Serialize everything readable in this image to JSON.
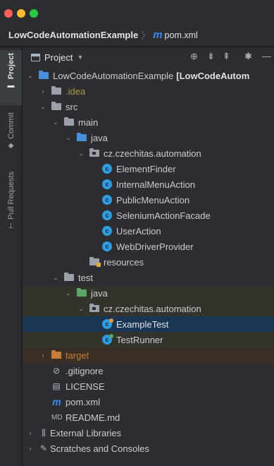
{
  "breadcrumb": {
    "project": "LowCodeAutomationExample",
    "separator": "〉",
    "file_icon": "m",
    "file": "pom.xml"
  },
  "side_tabs": {
    "project": "Project",
    "commit": "Commit",
    "pull_requests": "Pull Requests"
  },
  "toolbar": {
    "title": "Project",
    "caret": "▼",
    "locate_icon": "⊕",
    "expand_icon": "⇟",
    "collapse_icon": "⇞",
    "gear_icon": "✱",
    "hide_icon": "—"
  },
  "tree": {
    "root": {
      "name": "LowCodeAutomationExample",
      "suffix": "[LowCodeAutom"
    },
    "idea": ".idea",
    "src": "src",
    "main": "main",
    "main_java": "java",
    "main_pkg": "cz.czechitas.automation",
    "main_classes": [
      "ElementFinder",
      "InternalMenuAction",
      "PublicMenuAction",
      "SeleniumActionFacade",
      "UserAction",
      "WebDriverProvider"
    ],
    "resources": "resources",
    "test": "test",
    "test_java": "java",
    "test_pkg": "cz.czechitas.automation",
    "test_classes": [
      "ExampleTest",
      "TestRunner"
    ],
    "target": "target",
    "files": [
      ".gitignore",
      "LICENSE",
      "pom.xml",
      "README.md"
    ],
    "external_libraries": "External Libraries",
    "scratches": "Scratches and Consoles"
  },
  "icons": {
    "arrow_expanded": "⌄",
    "arrow_collapsed": "›",
    "class_letter": "c",
    "gitignore": "⊘",
    "license": "▤",
    "pom": "m",
    "readme": "MD",
    "libraries": "⫼",
    "scratches": "✎"
  },
  "colors": {
    "accent": "#3d8bf0",
    "selection": "#1b3655",
    "test_highlight": "#32332b",
    "excluded_highlight": "#3b2e24",
    "class_icon": "#2f9ce0",
    "target_folder": "#c77c3a",
    "idea_text": "#b39a45"
  }
}
